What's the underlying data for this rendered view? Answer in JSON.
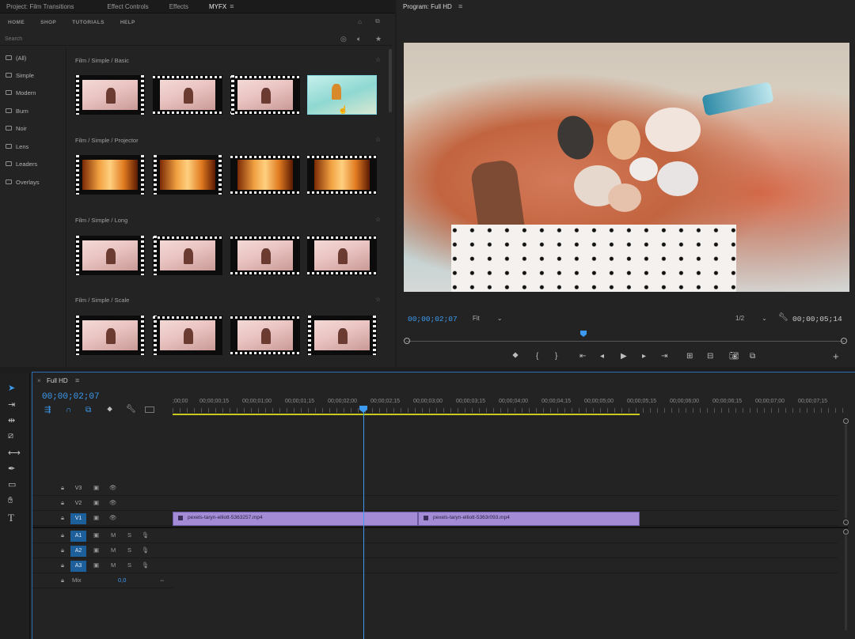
{
  "panel_tabs": [
    {
      "label": "Project: Film Transitions",
      "active": false
    },
    {
      "label": "Effect Controls",
      "active": false
    },
    {
      "label": "Effects",
      "active": false
    },
    {
      "label": "MYFX",
      "active": true
    }
  ],
  "myfx_nav": [
    "HOME",
    "SHOP",
    "TUTORIALS",
    "HELP"
  ],
  "search": {
    "placeholder": "Search"
  },
  "categories": [
    "(All)",
    "Simple",
    "Modern",
    "Burn",
    "Noir",
    "Lens",
    "Leaders",
    "Overlays"
  ],
  "sections": [
    {
      "title": "Film / Simple / Basic"
    },
    {
      "title": "Film / Simple / Projector"
    },
    {
      "title": "Film / Simple / Long"
    },
    {
      "title": "Film / Simple / Scale"
    }
  ],
  "program": {
    "title": "Program: Full HD",
    "timecode_current": "00;00;02;07",
    "fit": "Fit",
    "resolution": "1/2",
    "timecode_duration": "00;00;05;14"
  },
  "timeline": {
    "title": "Full HD",
    "timecode": "00;00;02;07",
    "ruler": [
      ";00;00",
      "00;00;00;15",
      "00;00;01;00",
      "00;00;01;15",
      "00;00;02;00",
      "00;00;02;15",
      "00;00;03;00",
      "00;00;03;15",
      "00;00;04;00",
      "00;00;04;15",
      "00;00;05;00",
      "00;00;05;15",
      "00;00;06;00",
      "00;00;06;15",
      "00;00;07;00",
      "00;00;07;15"
    ],
    "video_tracks": [
      {
        "label": "V3",
        "active": false
      },
      {
        "label": "V2",
        "active": false
      },
      {
        "label": "V1",
        "active": true
      }
    ],
    "audio_tracks": [
      {
        "label": "A1",
        "m": "M",
        "s": "S"
      },
      {
        "label": "A2",
        "m": "M",
        "s": "S"
      },
      {
        "label": "A3",
        "m": "M",
        "s": "S"
      }
    ],
    "mix": {
      "label": "Mix",
      "value": "0,0"
    },
    "clips": [
      {
        "name": "pexels-taryn-elliott-5363257.mp4"
      },
      {
        "name": "pexels-taryn-elliott-5363r093.mp4"
      }
    ]
  },
  "colors": {
    "accent_blue": "#3c9bf0",
    "clip_purple": "#a38bd6",
    "work_area": "#c8c820"
  }
}
